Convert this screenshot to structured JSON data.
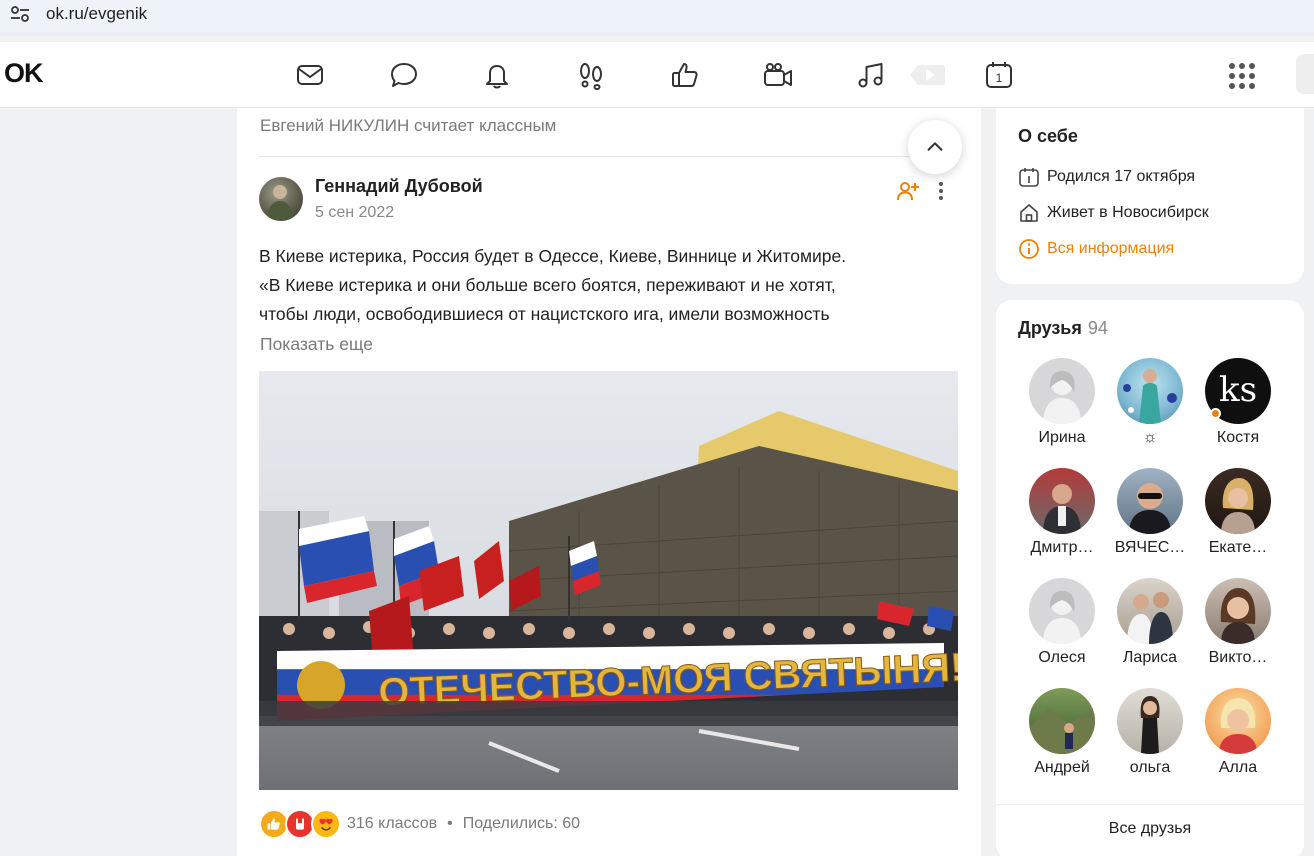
{
  "browser": {
    "url": "ok.ru/evgenik",
    "site_settings_icon": "tune-icon"
  },
  "header": {
    "logo": "OK",
    "nav_icons": [
      "mail-icon",
      "chat-icon",
      "bell-icon",
      "footprints-icon",
      "thumbs-up-icon",
      "video-camera-icon",
      "music-icon",
      "play-icon",
      "calendar-icon"
    ],
    "calendar_day": "1",
    "apps_icon": "apps-grid-icon",
    "accent_color": "#ee8208"
  },
  "feed": {
    "liked_by": "Евгений НИКУЛИН считает классным",
    "post": {
      "author": "Геннадий Дубовой",
      "date": "5 сен 2022",
      "text_lines": [
        "В Киеве истерика, Россия будет в Одессе, Киеве, Виннице и Житомире.",
        "«В Киеве истерика и они больше всего боятся, переживают и не хотят,",
        "чтобы люди, освободившиеся от нацистского ига, имели возможность"
      ],
      "show_more": "Показать еще",
      "photo_banner_text": "ОТЕЧЕСТВО-МОЯ СВЯТЫНЯ!",
      "reactions": [
        "like-reaction-icon",
        "rock-reaction-icon",
        "love-reaction-icon"
      ],
      "reaction_count": "316 классов",
      "separator": "•",
      "shares": "Поделились: 60"
    }
  },
  "about": {
    "title": "О себе",
    "born": "Родился 17 октября",
    "lives": "Живет в Новосибирск",
    "all_info": "Вся информация"
  },
  "friends": {
    "title": "Друзья",
    "count": "94",
    "list": [
      {
        "name": "Ирина",
        "online": false
      },
      {
        "name": "☼",
        "online": false
      },
      {
        "name": "Костя",
        "online": true,
        "avatar_text": "ks"
      },
      {
        "name": "Дмитр…",
        "online": false
      },
      {
        "name": "ВЯЧЕС…",
        "online": false
      },
      {
        "name": "Екате…",
        "online": false
      },
      {
        "name": "Олеся",
        "online": false
      },
      {
        "name": "Лариса",
        "online": false
      },
      {
        "name": "Викто…",
        "online": false
      },
      {
        "name": "Андрей",
        "online": false
      },
      {
        "name": "ольга",
        "online": false
      },
      {
        "name": "Алла",
        "online": false
      }
    ],
    "all_friends": "Все друзья"
  }
}
